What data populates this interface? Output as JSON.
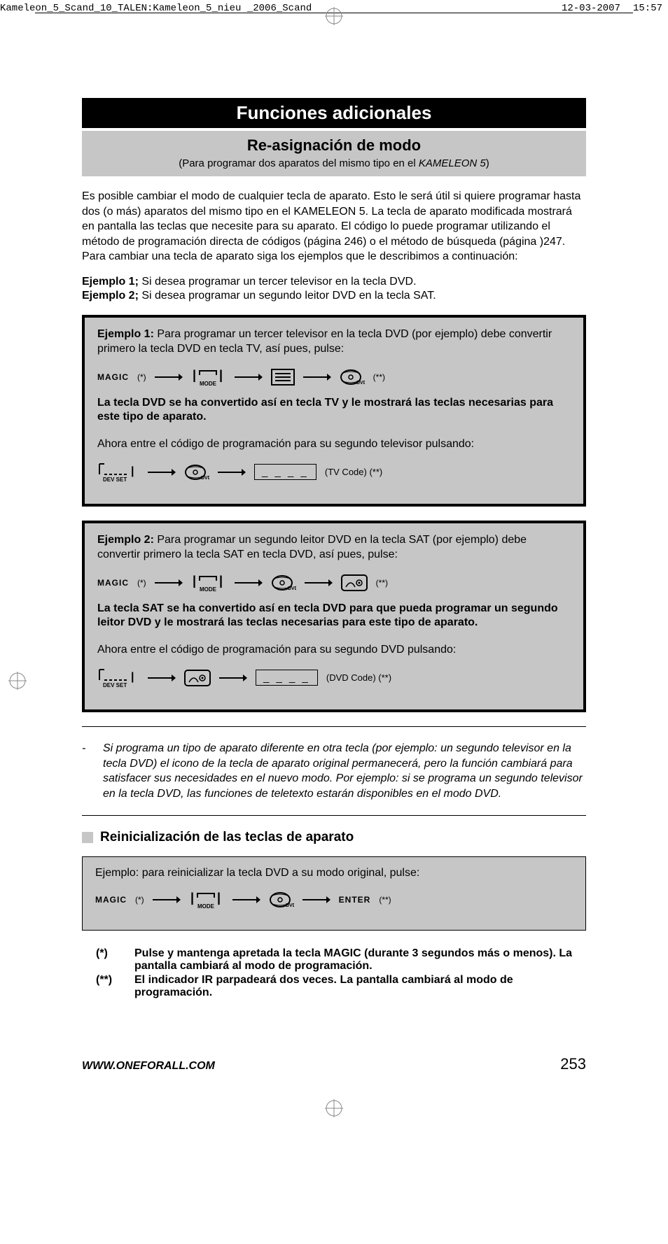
{
  "crop": {
    "filename": "Kameleon_5_Scand_10_TALEN:Kameleon_5_nieu _2006_Scand",
    "date": "12-03-2007",
    "time": "15:57"
  },
  "black_bar": "Funciones adicionales",
  "grey_bar": {
    "title": "Re-asignación de modo",
    "note_prefix": "(Para programar dos aparatos del mismo tipo en el ",
    "note_product": "KAMELEON 5",
    "note_suffix": ")"
  },
  "intro": "Es posible cambiar el modo de cualquier tecla de aparato. Esto le será útil si quiere programar hasta dos (o más) aparatos del mismo tipo en el KAMELEON 5. La tecla de aparato modificada mostrará en pantalla las teclas que necesite para su aparato. El código lo puede programar utilizando el método de programación directa de códigos (página 246) o el método de búsqueda (página )247. Para cambiar una tecla de aparato siga los ejemplos que le describimos a continuación:",
  "examples_intro": {
    "e1_label": "Ejemplo 1;",
    "e1_text": " Si desea programar un tercer televisor en la tecla DVD.",
    "e2_label": "Ejemplo 2;",
    "e2_text": " Si desea programar un segundo leitor DVD en la tecla SAT."
  },
  "example1": {
    "title": "Ejemplo 1:",
    "text": "Para programar un tercer televisor en la tecla DVD (por ejemplo) debe convertir primero la tecla DVD en tecla TV, así pues, pulse:",
    "seq1": {
      "magic": "MAGIC",
      "star": "(*)",
      "mode": "MODE",
      "dvd": "DVD",
      "dstar": "(**)"
    },
    "result": "La tecla DVD se ha convertido así en tecla TV y le mostrará las teclas necesarias para este tipo de aparato.",
    "text2": "Ahora entre el código de programación para su segundo televisor pulsando:",
    "seq2": {
      "devset": "DEV SET",
      "dvd": "DVD",
      "code_dashes": "_ _ _ _",
      "code_label": "(TV Code)  (**)"
    }
  },
  "example2": {
    "title": "Ejemplo 2:",
    "text": "Para programar un segundo leitor DVD en la tecla SAT (por ejemplo) debe convertir primero la tecla SAT en tecla DVD, así pues, pulse:",
    "seq1": {
      "magic": "MAGIC",
      "star": "(*)",
      "mode": "MODE",
      "dstar": "(**)"
    },
    "result": "La tecla SAT se ha convertido así en tecla DVD para que pueda programar un segundo leitor DVD y le mostrará las teclas necesarias para este tipo de aparato.",
    "text2": "Ahora entre el código de programación para su segundo DVD pulsando:",
    "seq2": {
      "devset": "DEV SET",
      "code_dashes": "_ _ _ _",
      "code_label": "(DVD Code) (**)"
    }
  },
  "note": "Si programa un tipo de aparato diferente en otra tecla (por ejemplo: un segundo televisor en la tecla DVD) el icono de la tecla de aparato original permanecerá, pero la función cambiará para satisfacer sus necesidades en el nuevo modo. Por ejemplo: si se programa un segundo televisor en la tecla DVD, las funciones de teletexto estarán disponibles en el modo DVD.",
  "reset_heading": "Reinicialización de las teclas de aparato",
  "reset_box": {
    "text": "Ejemplo: para reinicializar la tecla DVD a su modo original, pulse:",
    "seq": {
      "magic": "MAGIC",
      "star": "(*)",
      "mode": "MODE",
      "enter": "ENTER",
      "dstar": "(**)"
    }
  },
  "footnotes": {
    "star_mark": "(*)",
    "star_text": "Pulse y mantenga apretada la tecla MAGIC (durante 3 segundos más o menos). La pantalla cambiará al modo de programación.",
    "dstar_mark": "(**)",
    "dstar_text": "El indicador IR parpadeará dos veces. La pantalla cambiará al modo de programación."
  },
  "footer": {
    "url": "WWW.ONEFORALL.COM",
    "page": "253"
  }
}
